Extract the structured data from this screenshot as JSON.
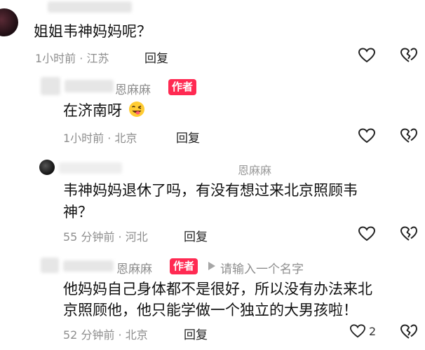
{
  "comments": [
    {
      "text": "姐姐韦神妈妈呢？",
      "time": "1小时前",
      "location": "江苏",
      "reply_label": "回复"
    },
    {
      "author": "恩麻麻",
      "badge": "作者",
      "text": "在济南呀",
      "time": "1小时前",
      "location": "北京",
      "reply_label": "回复"
    },
    {
      "author": "恩麻麻",
      "line1": "韦神妈妈退休了吗，有没有想过来北京照顾韦",
      "line2": "神？",
      "time": "55 分钟前",
      "location": "河北",
      "reply_label": "回复"
    },
    {
      "author": "恩麻麻",
      "badge": "作者",
      "reply_target": "请输入一个名字",
      "line1": "他妈妈自己身体都不是很好，所以没有办法来北",
      "line2": "京照顾他，他只能学做一个独立的大男孩啦！",
      "time": "52 分钟前",
      "location": "北京",
      "reply_label": "回复",
      "likes": "2"
    }
  ],
  "separator": " · ",
  "icons": {
    "like": "heart-icon",
    "dislike": "broken-heart-icon",
    "reply_arrow": "triangle-right-icon"
  },
  "colors": {
    "badge": "#ff2a52",
    "meta": "#8e8e8e"
  }
}
